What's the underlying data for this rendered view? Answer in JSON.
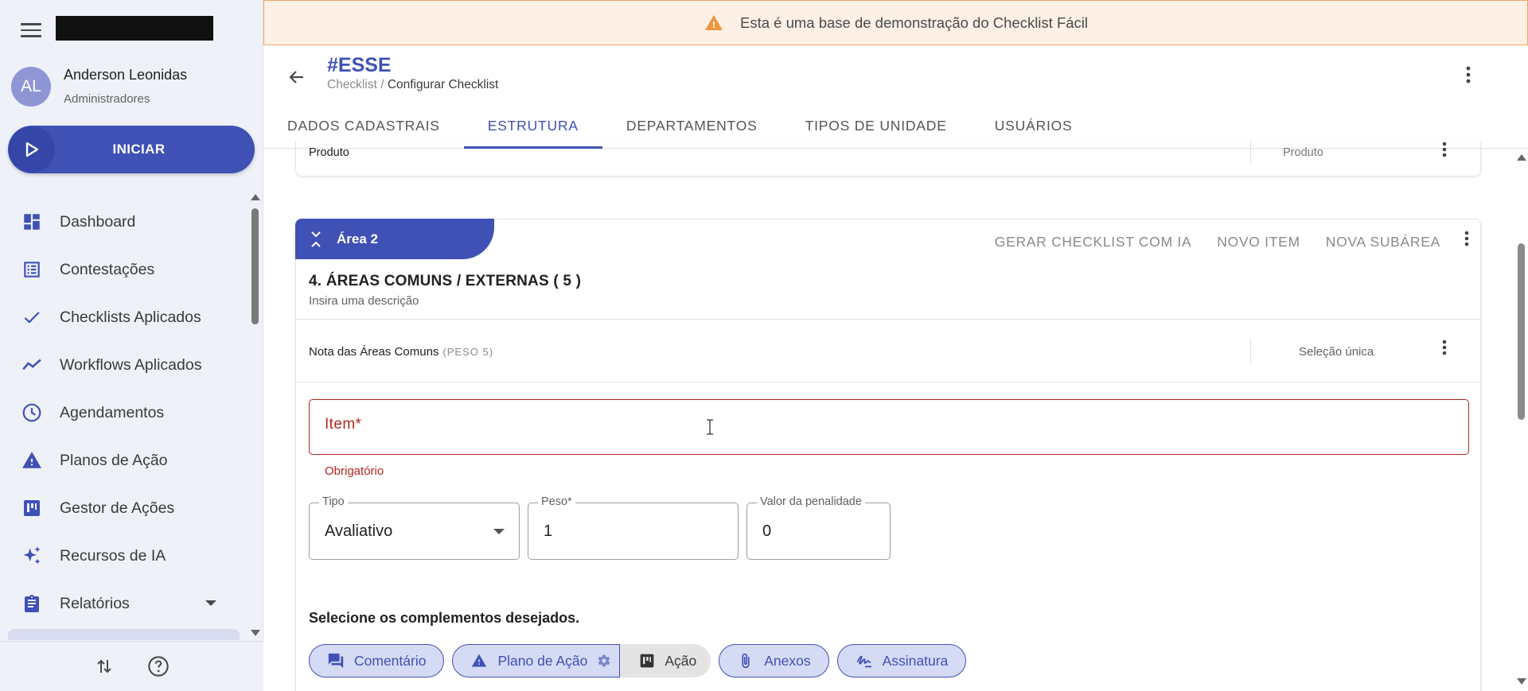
{
  "sidebar": {
    "user": {
      "initials": "AL",
      "name": "Anderson Leonidas",
      "role": "Administradores"
    },
    "start_label": "INICIAR",
    "items": [
      {
        "label": "Dashboard",
        "icon": "dashboard-icon"
      },
      {
        "label": "Contestações",
        "icon": "list-icon"
      },
      {
        "label": "Checklists Aplicados",
        "icon": "check-icon"
      },
      {
        "label": "Workflows Aplicados",
        "icon": "timeline-icon"
      },
      {
        "label": "Agendamentos",
        "icon": "clock-icon"
      },
      {
        "label": "Planos de Ação",
        "icon": "warning-icon"
      },
      {
        "label": "Gestor de Ações",
        "icon": "kanban-icon"
      },
      {
        "label": "Recursos de IA",
        "icon": "sparkles-icon"
      },
      {
        "label": "Relatórios",
        "icon": "clipboard-icon"
      }
    ]
  },
  "banner": {
    "text": "Esta é uma base de demonstração do Checklist Fácil",
    "color": "#f0a56b"
  },
  "header": {
    "title": "#ESSE",
    "breadcrumb_root": "Checklist",
    "breadcrumb_sep": " / ",
    "breadcrumb_current": "Configurar Checklist"
  },
  "tabs": [
    {
      "label": "DADOS CADASTRAIS",
      "active": false
    },
    {
      "label": "ESTRUTURA",
      "active": true
    },
    {
      "label": "DEPARTAMENTOS",
      "active": false
    },
    {
      "label": "TIPOS DE UNIDADE",
      "active": false
    },
    {
      "label": "USUÁRIOS",
      "active": false
    }
  ],
  "prev_item": {
    "label": "Produto",
    "type": "Produto"
  },
  "area": {
    "tag": "Área 2",
    "actions": [
      "GERAR CHECKLIST COM IA",
      "NOVO ITEM",
      "NOVA SUBÁREA"
    ],
    "title": "4. ÁREAS COMUNS / EXTERNAS ( 5 )",
    "description": "Insira uma descrição",
    "item": {
      "label": "Nota das Áreas Comuns",
      "peso": "(PESO 5)",
      "type": "Seleção única"
    }
  },
  "form": {
    "item_placeholder": "Item*",
    "item_error": "Obrigatório",
    "tipo_label": "Tipo",
    "tipo_value": "Avaliativo",
    "peso_label": "Peso*",
    "peso_value": "1",
    "penalidade_label": "Valor da penalidade",
    "penalidade_value": "0",
    "complements_title": "Selecione os complementos desejados.",
    "chips": {
      "comentario": "Comentário",
      "plano": "Plano de Ação",
      "acao": "Ação",
      "anexos": "Anexos",
      "assinatura": "Assinatura"
    }
  },
  "colors": {
    "primary": "#3f51b5",
    "error": "#b3261e",
    "chip_bg": "#d6dbf5",
    "sidebar_bg": "#eef1f8"
  }
}
